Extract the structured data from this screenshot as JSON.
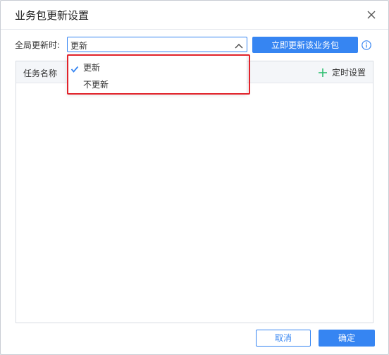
{
  "dialog": {
    "title": "业务包更新设置"
  },
  "global_update": {
    "label": "全局更新时:",
    "selected_value": "更新",
    "options": [
      {
        "label": "更新",
        "checked": true
      },
      {
        "label": "不更新",
        "checked": false
      }
    ]
  },
  "toolbar": {
    "update_now_label": "立即更新该业务包"
  },
  "table": {
    "column_task_name": "任务名称",
    "schedule_label": "定时设置",
    "rows": []
  },
  "footer": {
    "cancel_label": "取消",
    "ok_label": "确定"
  },
  "colors": {
    "accent": "#3685f2",
    "highlight": "#e1232b",
    "plus": "#2fbf71"
  },
  "icons": {
    "close": "close-icon",
    "arrow": "chevron-up-icon",
    "info": "info-icon",
    "plus": "plus-icon",
    "check": "check-icon"
  }
}
